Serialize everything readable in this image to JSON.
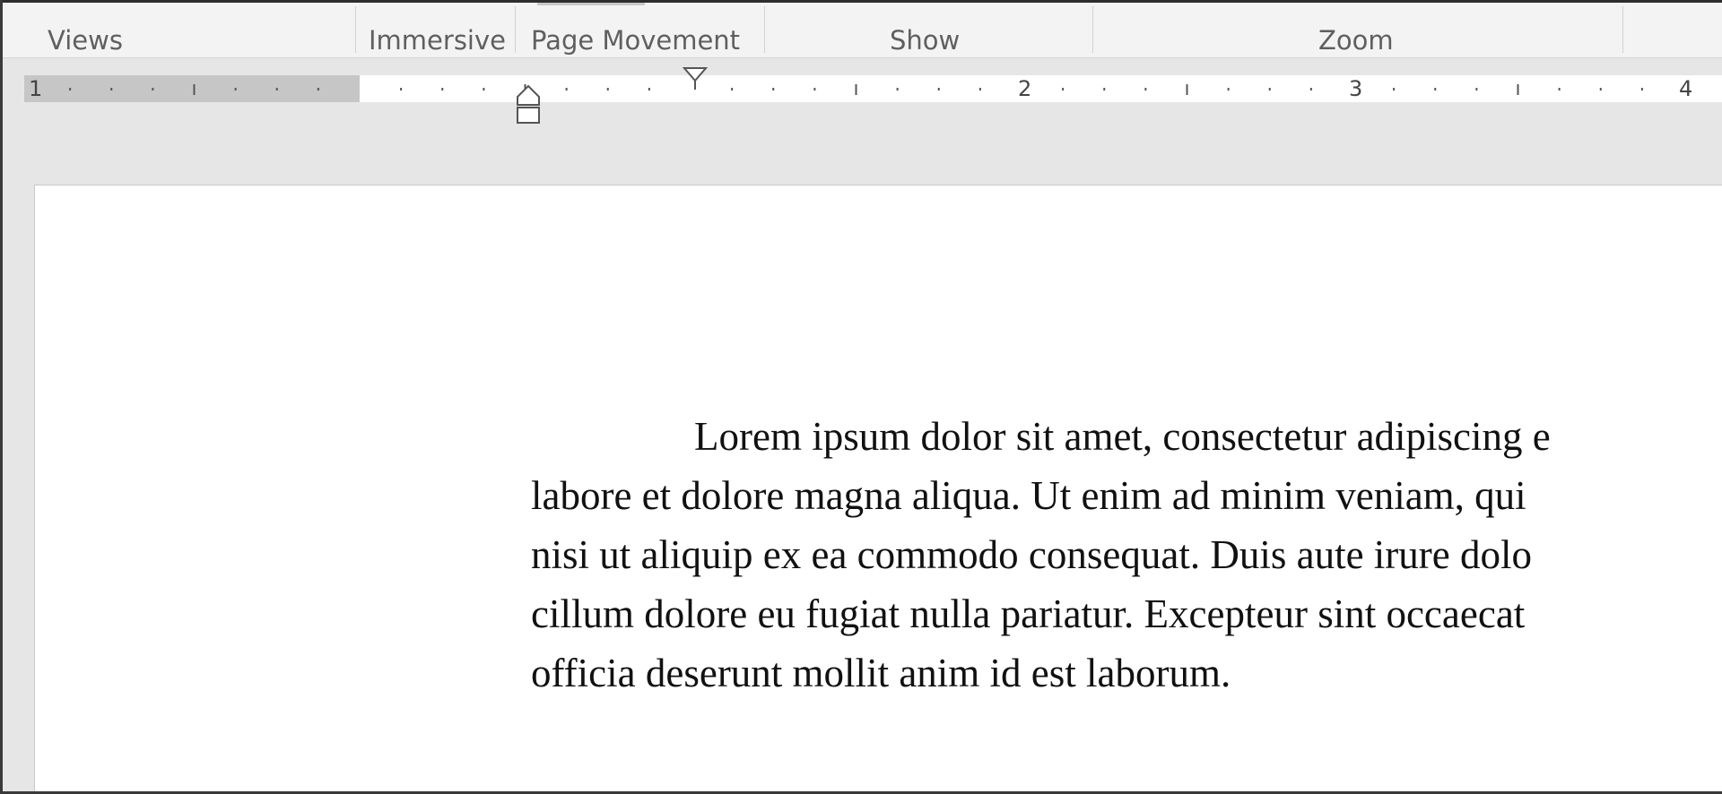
{
  "ribbon": {
    "groups": [
      {
        "label": "Views"
      },
      {
        "label": "Immersive"
      },
      {
        "label": "Page Movement"
      },
      {
        "label": "Show"
      },
      {
        "label": "Zoom"
      }
    ]
  },
  "ruler": {
    "numbers": [
      "1",
      "2",
      "3",
      "4"
    ],
    "icons": {
      "first_line_indent": "first-line-indent-marker",
      "hanging_indent": "hanging-indent-marker"
    }
  },
  "document": {
    "lines": [
      "Lorem ipsum dolor sit amet, consectetur adipiscing e",
      "labore et dolore magna aliqua. Ut enim ad minim veniam, qui",
      "nisi ut aliquip ex ea commodo consequat. Duis aute irure dolo",
      "cillum dolore eu fugiat nulla pariatur. Excepteur sint occaecat",
      "officia deserunt mollit anim id est laborum."
    ]
  },
  "colors": {
    "ribbon_bg": "#f3f3f3",
    "workspace_bg": "#e6e6e6",
    "ruler_margin": "#c6c6c6",
    "page_bg": "#ffffff"
  }
}
